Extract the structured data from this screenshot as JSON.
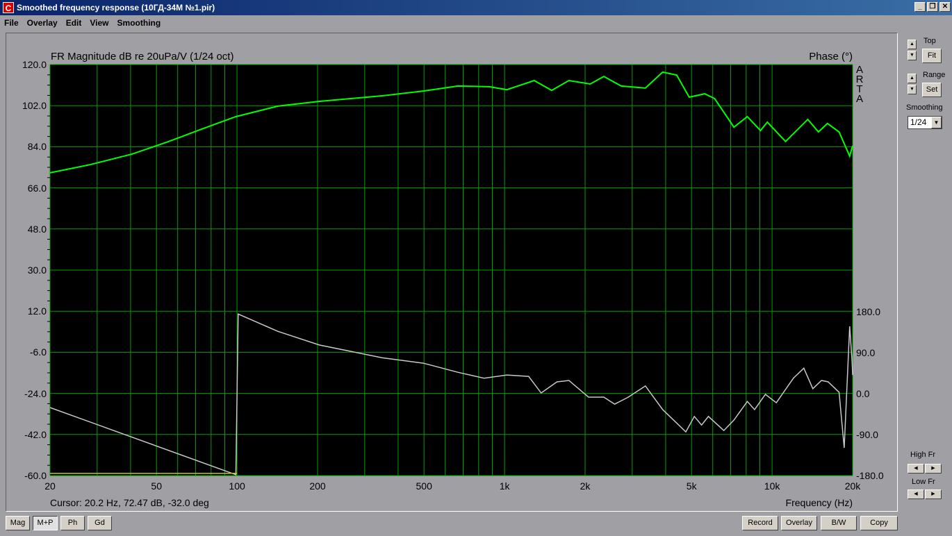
{
  "window": {
    "title": "Smoothed frequency response (10ГД-34М №1.pir)",
    "controls": [
      "_",
      "❐",
      "✕"
    ]
  },
  "menu": [
    "File",
    "Overlay",
    "Edit",
    "View",
    "Smoothing"
  ],
  "side": {
    "top_label": "Top",
    "fit": "Fit",
    "range_label": "Range",
    "set": "Set",
    "smoothing_label": "Smoothing",
    "smoothing_value": "1/24",
    "high_fr": "High Fr",
    "low_fr": "Low Fr"
  },
  "bottom_left": [
    "Mag",
    "M+P",
    "Ph",
    "Gd"
  ],
  "bottom_right": [
    "Record",
    "Overlay",
    "B/W",
    "Copy"
  ],
  "status": {
    "cursor": "Cursor: 20.2 Hz, 72.47 dB, -32.0 deg"
  },
  "watermark": "ARTA",
  "chart_data": {
    "type": "line",
    "title": "FR Magnitude dB re 20uPa/V (1/24 oct)",
    "y2label": "Phase (°)",
    "xlabel": "Frequency (Hz)",
    "xscale": "log",
    "xlim": [
      20,
      20000
    ],
    "ylim": [
      -60,
      120
    ],
    "y2lim": [
      -180,
      180
    ],
    "xticks": [
      {
        "v": 20,
        "l": "20"
      },
      {
        "v": 50,
        "l": "50"
      },
      {
        "v": 100,
        "l": "100"
      },
      {
        "v": 200,
        "l": "200"
      },
      {
        "v": 500,
        "l": "500"
      },
      {
        "v": 1000,
        "l": "1k"
      },
      {
        "v": 2000,
        "l": "2k"
      },
      {
        "v": 5000,
        "l": "5k"
      },
      {
        "v": 10000,
        "l": "10k"
      },
      {
        "v": 20000,
        "l": "20k"
      }
    ],
    "yticks": [
      "120.0",
      "102.0",
      "84.0",
      "66.0",
      "48.0",
      "30.0",
      "12.0",
      "-6.0",
      "-24.0",
      "-42.0",
      "-60.0"
    ],
    "y2ticks": [
      "180.0",
      "90.0",
      "0.0",
      "-90.0",
      "-180.0"
    ],
    "grid": true,
    "series": [
      {
        "name": "magnitude",
        "axis": "left",
        "color": "#00ff00",
        "points": [
          [
            20,
            72.6
          ],
          [
            28.3,
            76.2
          ],
          [
            40.5,
            80.8
          ],
          [
            54.6,
            86
          ],
          [
            73.6,
            91.7
          ],
          [
            99,
            97.2
          ],
          [
            142,
            101.8
          ],
          [
            203,
            103.9
          ],
          [
            348,
            106.3
          ],
          [
            497,
            108.4
          ],
          [
            669,
            110.6
          ],
          [
            876,
            110.3
          ],
          [
            1020,
            109
          ],
          [
            1290,
            113
          ],
          [
            1500,
            108.7
          ],
          [
            1740,
            113
          ],
          [
            2090,
            111.5
          ],
          [
            2350,
            114.8
          ],
          [
            2730,
            110.6
          ],
          [
            3360,
            109.7
          ],
          [
            3900,
            116.7
          ],
          [
            4400,
            115.4
          ],
          [
            4900,
            105.7
          ],
          [
            5600,
            107.2
          ],
          [
            6100,
            105.1
          ],
          [
            7200,
            92.6
          ],
          [
            8080,
            97.2
          ],
          [
            9050,
            91.1
          ],
          [
            9600,
            94.8
          ],
          [
            11230,
            86.3
          ],
          [
            13600,
            96
          ],
          [
            14900,
            90.5
          ],
          [
            16100,
            94.2
          ],
          [
            17800,
            90.5
          ],
          [
            19500,
            79.9
          ],
          [
            20000,
            84.4
          ]
        ]
      },
      {
        "name": "phase",
        "axis": "right",
        "color": "#c8c8c8",
        "points": [
          [
            20,
            -30.5
          ],
          [
            99,
            -178
          ],
          [
            101,
            175
          ],
          [
            142,
            137
          ],
          [
            203,
            107
          ],
          [
            348,
            79
          ],
          [
            497,
            67
          ],
          [
            669,
            47
          ],
          [
            838,
            34
          ],
          [
            1020,
            41
          ],
          [
            1230,
            38
          ],
          [
            1370,
            1.5
          ],
          [
            1570,
            26
          ],
          [
            1740,
            29
          ],
          [
            2060,
            -7.6
          ],
          [
            2350,
            -7.6
          ],
          [
            2580,
            -23
          ],
          [
            2900,
            -7.6
          ],
          [
            3360,
            17
          ],
          [
            3900,
            -35
          ],
          [
            4760,
            -84
          ],
          [
            5120,
            -50
          ],
          [
            5450,
            -69
          ],
          [
            5780,
            -50
          ],
          [
            6600,
            -81
          ],
          [
            7200,
            -58
          ],
          [
            8080,
            -17
          ],
          [
            8600,
            -35
          ],
          [
            9440,
            -1.5
          ],
          [
            10370,
            -20
          ],
          [
            12010,
            34
          ],
          [
            13140,
            56
          ],
          [
            14200,
            11
          ],
          [
            15300,
            29
          ],
          [
            16200,
            26
          ],
          [
            17800,
            3
          ],
          [
            18600,
            -119
          ],
          [
            19500,
            148
          ],
          [
            19900,
            72
          ],
          [
            20000,
            41
          ]
        ]
      },
      {
        "name": "overlay-low",
        "axis": "left",
        "color": "#c8c800",
        "points": [
          [
            20,
            -59
          ],
          [
            100,
            -59
          ]
        ]
      }
    ]
  }
}
